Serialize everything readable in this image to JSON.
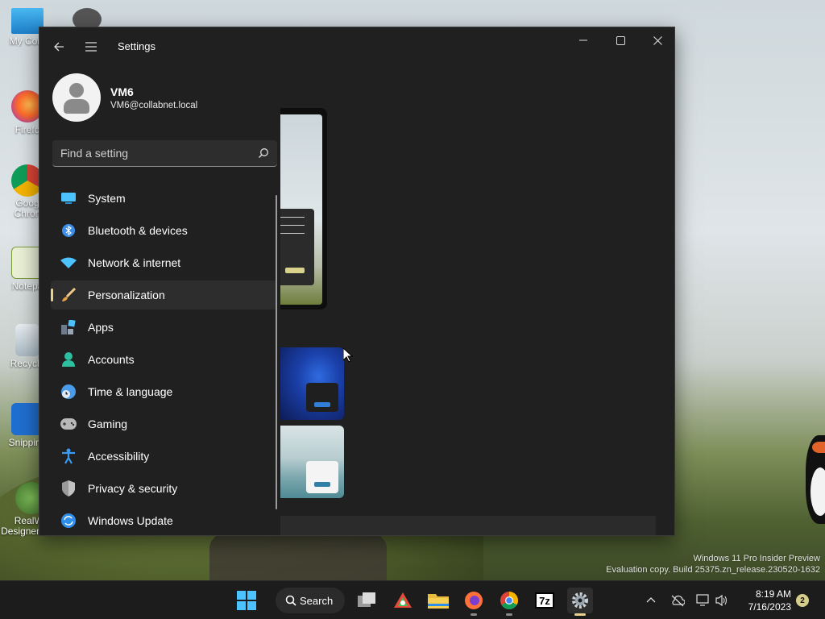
{
  "desktop": {
    "icons": [
      {
        "label": "My Com"
      },
      {
        "label": "Firefo"
      },
      {
        "label": "Goog Chron"
      },
      {
        "label": "Notepa"
      },
      {
        "label": "Recycle"
      },
      {
        "label": "Snipping"
      },
      {
        "label": "RealWo Designer Web"
      }
    ],
    "watermark": {
      "line1": "Windows 11 Pro Insider Preview",
      "line2": "Evaluation copy. Build 25375.zn_release.230520-1632"
    }
  },
  "window": {
    "title": "Settings",
    "back_icon": "back-arrow-icon",
    "menu_icon": "hamburger-menu-icon",
    "minimize_icon": "minimize-icon",
    "maximize_icon": "maximize-icon",
    "close_icon": "close-icon"
  },
  "profile": {
    "name": "VM6",
    "email": "VM6@collabnet.local"
  },
  "search": {
    "placeholder": "Find a setting",
    "value": ""
  },
  "nav": {
    "selected": "Personalization",
    "items": [
      {
        "label": "System",
        "icon": "system-monitor-icon",
        "color": "#4cc2ff"
      },
      {
        "label": "Bluetooth & devices",
        "icon": "bluetooth-icon",
        "color": "#3b8eea"
      },
      {
        "label": "Network & internet",
        "icon": "wifi-icon",
        "color": "#4cc2ff"
      },
      {
        "label": "Personalization",
        "icon": "paintbrush-icon",
        "color": "#e8a24a"
      },
      {
        "label": "Apps",
        "icon": "apps-grid-icon",
        "color": "#9aa4b2"
      },
      {
        "label": "Accounts",
        "icon": "person-icon",
        "color": "#2dbfa0"
      },
      {
        "label": "Time & language",
        "icon": "globe-clock-icon",
        "color": "#4a9be8"
      },
      {
        "label": "Gaming",
        "icon": "gamepad-icon",
        "color": "#b8b8b8"
      },
      {
        "label": "Accessibility",
        "icon": "accessibility-icon",
        "color": "#3b9af0"
      },
      {
        "label": "Privacy & security",
        "icon": "shield-icon",
        "color": "#9a9a9a"
      },
      {
        "label": "Windows Update",
        "icon": "update-sync-icon",
        "color": "#2f8fe8"
      }
    ]
  },
  "taskbar": {
    "search_label": "Search",
    "apps": [
      {
        "name": "start-button-icon"
      },
      {
        "name": "task-view-icon"
      },
      {
        "name": "app-icon"
      },
      {
        "name": "file-explorer-icon"
      },
      {
        "name": "firefox-icon"
      },
      {
        "name": "chrome-icon"
      },
      {
        "name": "7zip-icon",
        "text": "7z"
      },
      {
        "name": "settings-gear-icon"
      }
    ],
    "clock": {
      "time": "8:19 AM",
      "date": "7/16/2023"
    },
    "notifications": "2",
    "accent": "#e5d38c"
  }
}
